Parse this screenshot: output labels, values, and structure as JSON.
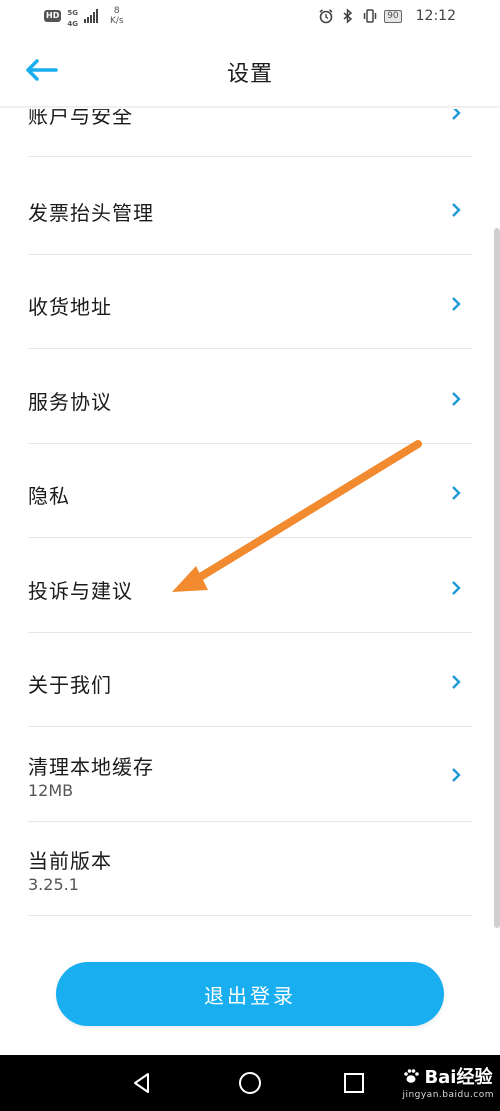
{
  "status_bar": {
    "hd": "HD",
    "net_top": "5G",
    "net_bottom": "4G",
    "speed_value": "8",
    "speed_unit": "K/s",
    "battery": "90",
    "time": "12:12"
  },
  "header": {
    "title": "设置",
    "back_icon": "arrow-left-icon"
  },
  "settings": {
    "items": [
      {
        "label": "账户与安全"
      },
      {
        "label": "发票抬头管理"
      },
      {
        "label": "收货地址"
      },
      {
        "label": "服务协议"
      },
      {
        "label": "隐私"
      },
      {
        "label": "投诉与建议"
      },
      {
        "label": "关于我们"
      },
      {
        "label": "清理本地缓存",
        "sub": "12MB"
      },
      {
        "label": "当前版本",
        "sub": "3.25.1"
      }
    ]
  },
  "logout": {
    "label": "退出登录"
  },
  "watermark": {
    "brand": "Bai经验",
    "url": "jingyan.baidu.com"
  },
  "colors": {
    "accent": "#18aef0",
    "arrow_annotation": "#f28a30",
    "chevron": "#1a9ad6"
  }
}
